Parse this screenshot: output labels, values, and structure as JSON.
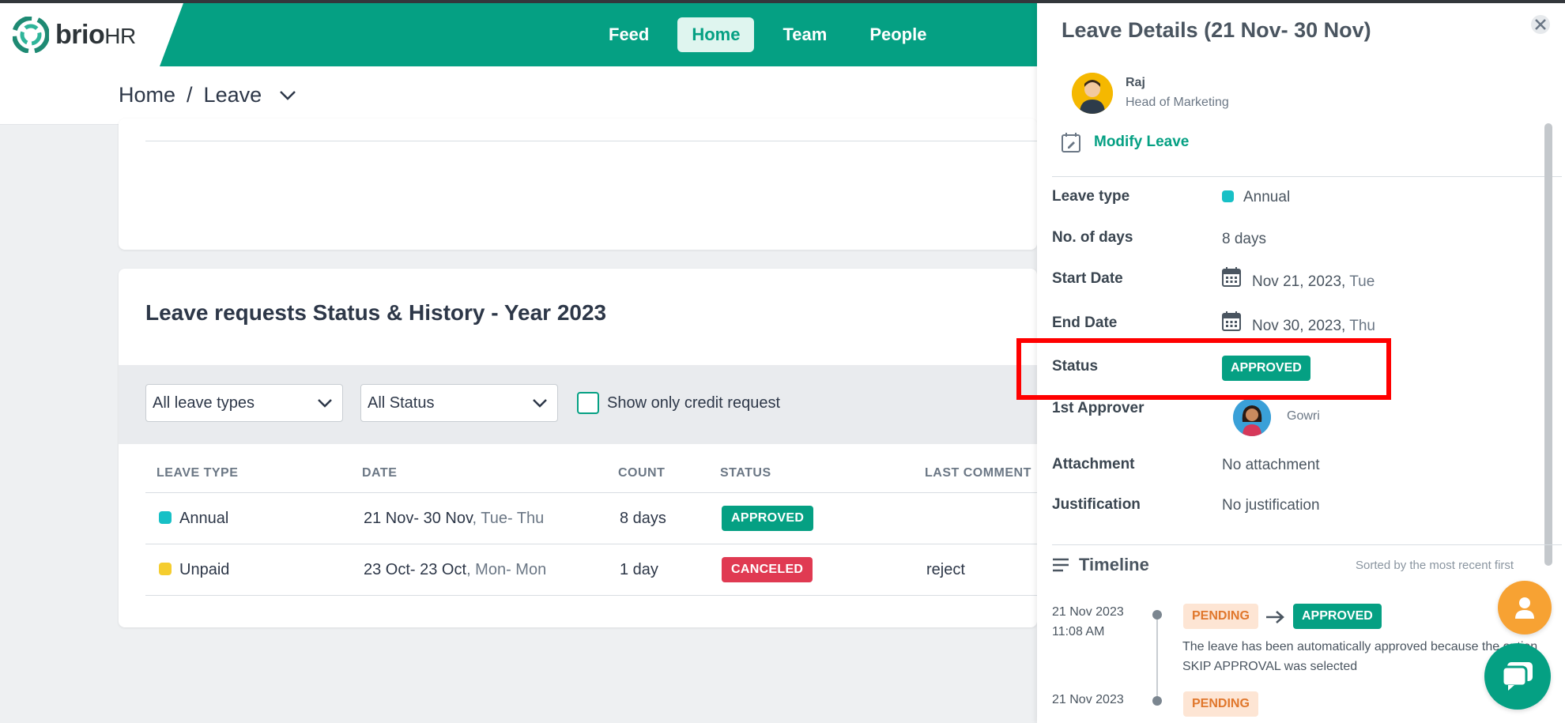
{
  "app": {
    "logo_text": "brio",
    "logo_suffix": "HR"
  },
  "nav": {
    "items": [
      {
        "label": "Feed",
        "active": false
      },
      {
        "label": "Home",
        "active": true
      },
      {
        "label": "Team",
        "active": false
      },
      {
        "label": "People",
        "active": false
      }
    ]
  },
  "breadcrumb": {
    "home": "Home",
    "separator": "/",
    "current": "Leave"
  },
  "history": {
    "title": "Leave requests Status & History - Year 2023",
    "filters": {
      "leave_type": "All leave types",
      "status": "All Status",
      "credit_only_label": "Show only credit request"
    },
    "columns": [
      "LEAVE TYPE",
      "DATE",
      "COUNT",
      "STATUS",
      "LAST COMMENT"
    ],
    "rows": [
      {
        "type": "Annual",
        "type_color": "#17c0c6",
        "date": "21 Nov- 30 Nov",
        "days": ", Tue- Thu",
        "count": "8 days",
        "status": "APPROVED",
        "comment": ""
      },
      {
        "type": "Unpaid",
        "type_color": "#f5cd2f",
        "date": "23 Oct- 23 Oct",
        "days": ", Mon- Mon",
        "count": "1 day",
        "status": "CANCELED",
        "comment": "reject"
      }
    ]
  },
  "details": {
    "title": "Leave Details (21 Nov- 30 Nov)",
    "user_name": "Raj",
    "user_role": "Head of Marketing",
    "modify_label": "Modify Leave",
    "leave_type_label": "Leave type",
    "leave_type_value": "Annual",
    "days_label": "No. of days",
    "days_value": "8 days",
    "start_label": "Start Date",
    "start_value": "Nov 21, 2023,",
    "start_day": "Tue",
    "end_label": "End Date",
    "end_value": "Nov 30, 2023,",
    "end_day": "Thu",
    "status_label": "Status",
    "status_value": "APPROVED",
    "approver_label": "1st Approver",
    "approver_name": "Gowri",
    "attachment_label": "Attachment",
    "attachment_value": "No attachment",
    "justification_label": "Justification",
    "justification_value": "No justification"
  },
  "timeline": {
    "title": "Timeline",
    "sort_note": "Sorted by the most recent first",
    "entries": [
      {
        "date": "21 Nov 2023",
        "time": "11:08 AM",
        "from": "PENDING",
        "to": "APPROVED",
        "description": "The leave has been automatically approved because the option SKIP APPROVAL was selected"
      },
      {
        "date": "21 Nov 2023",
        "from": "PENDING"
      }
    ]
  },
  "colors": {
    "brand": "#05a083",
    "danger": "#e03a52",
    "highlight": "#ff0000",
    "fab_user": "#f7a233"
  }
}
